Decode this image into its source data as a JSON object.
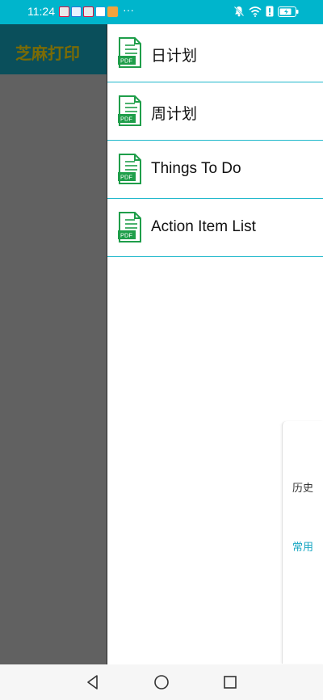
{
  "status_bar": {
    "time": "11:24",
    "more": "···"
  },
  "app": {
    "title": "芝麻打印"
  },
  "list": {
    "items": [
      {
        "label": "日计划",
        "icon": "pdf-file-icon"
      },
      {
        "label": "周计划",
        "icon": "pdf-file-icon"
      },
      {
        "label": "Things To Do",
        "icon": "pdf-file-icon"
      },
      {
        "label": "Action Item List",
        "icon": "pdf-file-icon"
      }
    ]
  },
  "side_tabs": {
    "history": "历史",
    "common": "常用"
  },
  "colors": {
    "status_bar": "#00b5cc",
    "accent": "#16a6c2",
    "pdf_green": "#1f9e4a",
    "left_panel": "#616161",
    "left_header": "#0a4f5b",
    "title_text": "#7a6b06"
  }
}
